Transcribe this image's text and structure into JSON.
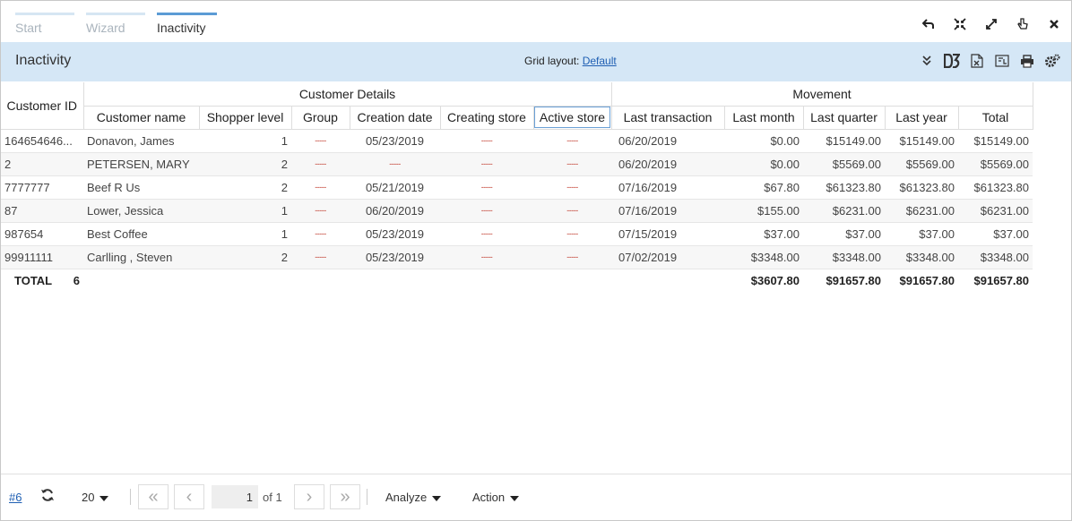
{
  "tabs": [
    {
      "label": "Start"
    },
    {
      "label": "Wizard"
    },
    {
      "label": "Inactivity"
    }
  ],
  "window_controls": [
    "undo-icon",
    "shrink-icon",
    "expand-icon",
    "pointer-icon",
    "close-icon"
  ],
  "header": {
    "title": "Inactivity",
    "grid_layout_label": "Grid layout:",
    "grid_layout_value": "Default"
  },
  "toolbar_icons": [
    "collapse-icon",
    "d3-icon",
    "excel-export-icon",
    "pdf-export-icon",
    "print-icon",
    "settings-icon"
  ],
  "grid": {
    "group_headers": {
      "customer_id": "Customer ID",
      "customer_details": "Customer Details",
      "movement": "Movement"
    },
    "columns": [
      "Customer name",
      "Shopper level",
      "Group",
      "Creation date",
      "Creating store",
      "Active store",
      "Last transaction",
      "Last month",
      "Last quarter",
      "Last year",
      "Total"
    ],
    "rows": [
      {
        "id": "164654646...",
        "name": "Donavon, James",
        "level": "1",
        "group": "-----",
        "created": "05/23/2019",
        "creating_store": "-----",
        "active_store": "-----",
        "last_tx": "06/20/2019",
        "last_month": "$0.00",
        "last_quarter": "$15149.00",
        "last_year": "$15149.00",
        "total": "$15149.00"
      },
      {
        "id": "2",
        "name": "PETERSEN, MARY",
        "level": "2",
        "group": "-----",
        "created": "-----",
        "creating_store": "-----",
        "active_store": "-----",
        "last_tx": "06/20/2019",
        "last_month": "$0.00",
        "last_quarter": "$5569.00",
        "last_year": "$5569.00",
        "total": "$5569.00"
      },
      {
        "id": "7777777",
        "name": "Beef R Us",
        "level": "2",
        "group": "-----",
        "created": "05/21/2019",
        "creating_store": "-----",
        "active_store": "-----",
        "last_tx": "07/16/2019",
        "last_month": "$67.80",
        "last_quarter": "$61323.80",
        "last_year": "$61323.80",
        "total": "$61323.80"
      },
      {
        "id": "87",
        "name": "Lower, Jessica",
        "level": "1",
        "group": "-----",
        "created": "06/20/2019",
        "creating_store": "-----",
        "active_store": "-----",
        "last_tx": "07/16/2019",
        "last_month": "$155.00",
        "last_quarter": "$6231.00",
        "last_year": "$6231.00",
        "total": "$6231.00"
      },
      {
        "id": "987654",
        "name": "Best Coffee",
        "level": "1",
        "group": "-----",
        "created": "05/23/2019",
        "creating_store": "-----",
        "active_store": "-----",
        "last_tx": "07/15/2019",
        "last_month": "$37.00",
        "last_quarter": "$37.00",
        "last_year": "$37.00",
        "total": "$37.00"
      },
      {
        "id": "99911111",
        "name": "Carlling , Steven",
        "level": "2",
        "group": "-----",
        "created": "05/23/2019",
        "creating_store": "-----",
        "active_store": "-----",
        "last_tx": "07/02/2019",
        "last_month": "$3348.00",
        "last_quarter": "$3348.00",
        "last_year": "$3348.00",
        "total": "$3348.00"
      }
    ],
    "total": {
      "label": "TOTAL",
      "count": "6",
      "last_month": "$3607.80",
      "last_quarter": "$91657.80",
      "last_year": "$91657.80",
      "total": "$91657.80"
    }
  },
  "footer": {
    "link": "#6",
    "page_size": "20",
    "page": "1",
    "of_pages": "of 1",
    "analyze": "Analyze",
    "action": "Action"
  }
}
